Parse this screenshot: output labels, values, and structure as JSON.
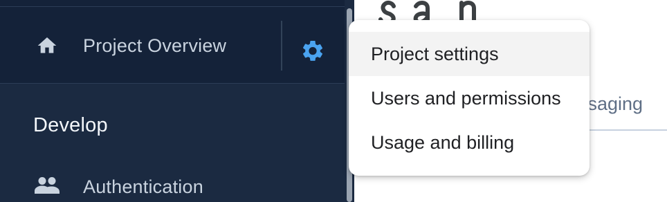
{
  "colors": {
    "sidebar_background": "#1b2a41",
    "sidebar_active": "#142239",
    "settings_accent": "#4aa3f0",
    "menu_background": "#ffffff",
    "menu_highlight": "#f3f3f3"
  },
  "sidebar": {
    "overview": {
      "label": "Project Overview",
      "icon": "home-icon",
      "settings_icon": "gear-icon"
    },
    "section_title": "Develop",
    "items": [
      {
        "label": "Authentication",
        "icon": "people-icon"
      }
    ]
  },
  "main": {
    "tab_fragment": "ssaging"
  },
  "settings_menu": {
    "items": [
      {
        "label": "Project settings",
        "active": true
      },
      {
        "label": "Users and permissions",
        "active": false
      },
      {
        "label": "Usage and billing",
        "active": false
      }
    ]
  }
}
